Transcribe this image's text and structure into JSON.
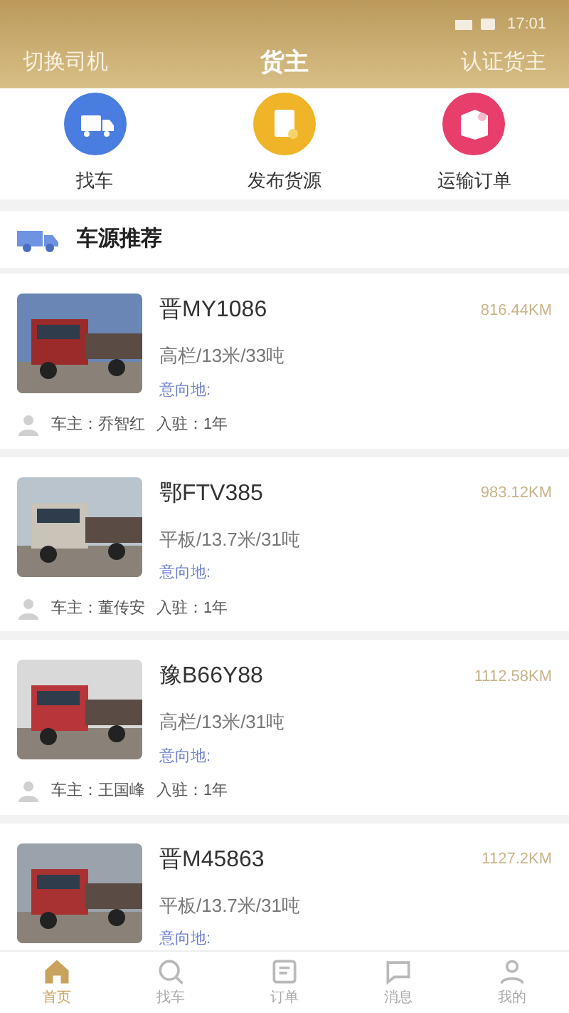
{
  "status_bar": {
    "time": "17:01"
  },
  "header": {
    "left": "切换司机",
    "title": "货主",
    "right": "认证货主"
  },
  "actions": [
    {
      "label": "找车",
      "kind": "truck",
      "color": "#4a7de0"
    },
    {
      "label": "发布货源",
      "kind": "document",
      "color": "#f0b429"
    },
    {
      "label": "运输订单",
      "kind": "order",
      "color": "#e83e6c"
    }
  ],
  "section": {
    "title": "车源推荐"
  },
  "vehicles": [
    {
      "plate": "晋MY1086",
      "distance": "816.44KM",
      "spec": "高栏/13米/33吨",
      "destination": "意向地:",
      "owner": "车主：乔智红",
      "joined": "入驻：1年"
    },
    {
      "plate": "鄂FTV385",
      "distance": "983.12KM",
      "spec": "平板/13.7米/31吨",
      "destination": "意向地:",
      "owner": "车主：董传安",
      "joined": "入驻：1年"
    },
    {
      "plate": "豫B66Y88",
      "distance": "1112.58KM",
      "spec": "高栏/13米/31吨",
      "destination": "意向地:",
      "owner": "车主：王国峰",
      "joined": "入驻：1年"
    },
    {
      "plate": "晋M45863",
      "distance": "1127.2KM",
      "spec": "平板/13.7米/31吨",
      "destination": "意向地:"
    }
  ],
  "tabs": [
    {
      "label": "首页",
      "kind": "home",
      "selected": true
    },
    {
      "label": "找车",
      "kind": "search",
      "selected": false
    },
    {
      "label": "订单",
      "kind": "order",
      "selected": false
    },
    {
      "label": "消息",
      "kind": "message",
      "selected": false
    },
    {
      "label": "我的",
      "kind": "user",
      "selected": false
    }
  ]
}
